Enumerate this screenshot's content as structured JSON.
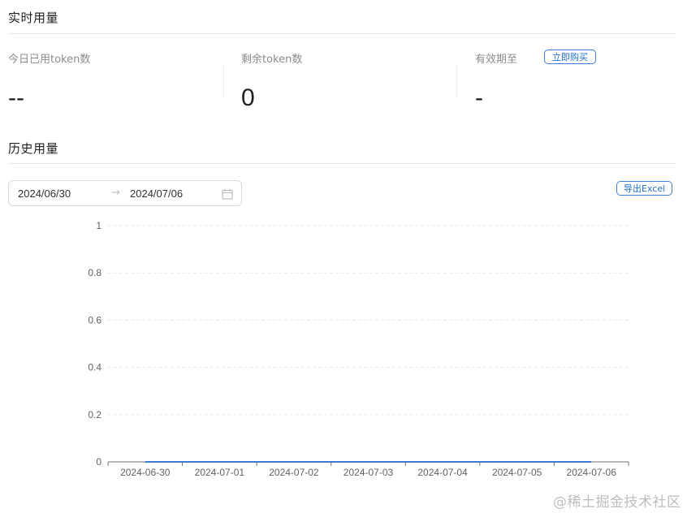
{
  "realtime": {
    "title": "实时用量",
    "stats": [
      {
        "label": "今日已用token数",
        "value": "--"
      },
      {
        "label": "剩余token数",
        "value": "0"
      },
      {
        "label": "有效期至",
        "value": "-"
      }
    ],
    "buy_button": "立即购买"
  },
  "history": {
    "title": "历史用量",
    "date_start": "2024/06/30",
    "date_arrow": "→",
    "date_end": "2024/07/06",
    "calendar_icon": "calendar-icon",
    "export_button": "导出Excel"
  },
  "chart_data": {
    "type": "line",
    "categories": [
      "2024-06-30",
      "2024-07-01",
      "2024-07-02",
      "2024-07-03",
      "2024-07-04",
      "2024-07-05",
      "2024-07-06"
    ],
    "series": [
      {
        "values": [
          0,
          0,
          0,
          0,
          0,
          0,
          0
        ],
        "color": "#3a7bd5"
      }
    ],
    "yticks": [
      "0",
      "0.2",
      "0.4",
      "0.6",
      "0.8",
      "1"
    ],
    "ylim": [
      0,
      1
    ],
    "grid": true
  },
  "watermark": "@稀土掘金技术社区"
}
